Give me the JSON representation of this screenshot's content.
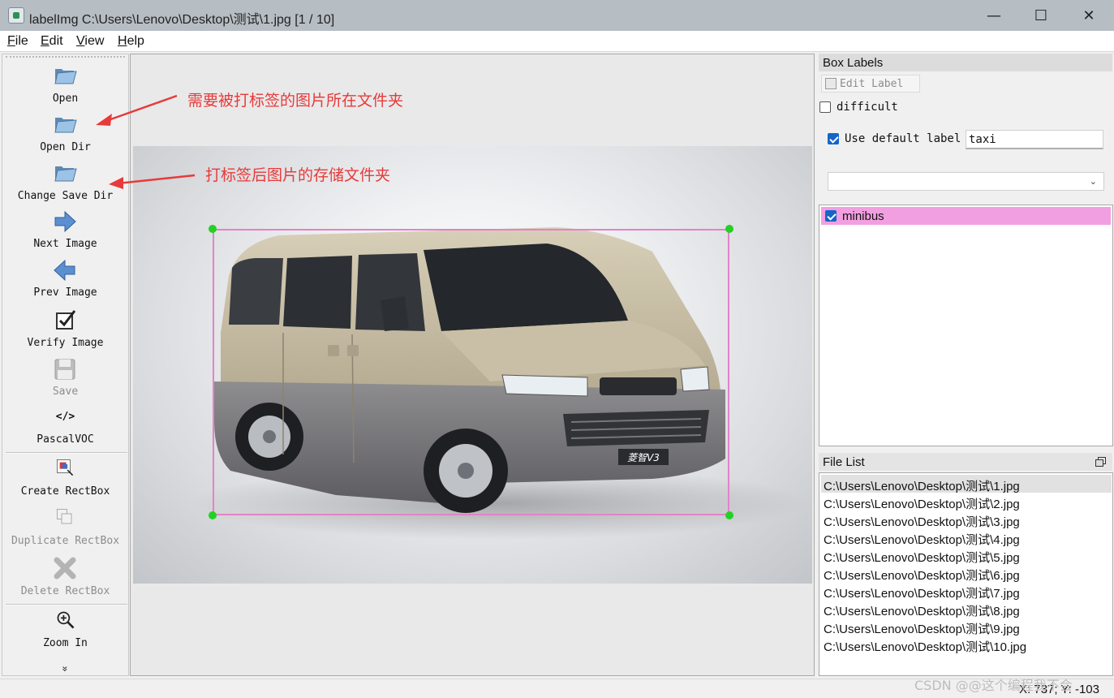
{
  "window": {
    "title": "labelImg C:\\Users\\Lenovo\\Desktop\\测试\\1.jpg [1 / 10]",
    "minimize": "—",
    "maximize": "☐",
    "close": "✕"
  },
  "menu": [
    "File",
    "Edit",
    "View",
    "Help"
  ],
  "toolbar": {
    "open": "Open",
    "open_dir": "Open Dir",
    "change_save_dir": "Change Save Dir",
    "next_image": "Next Image",
    "prev_image": "Prev Image",
    "verify_image": "Verify Image",
    "save": "Save",
    "format_icon_text": "</>",
    "format": "PascalVOC",
    "create_rectbox": "Create RectBox",
    "duplicate_rectbox": "Duplicate RectBox",
    "delete_rectbox": "Delete RectBox",
    "zoom_in": "Zoom In",
    "more": "»"
  },
  "annotations": {
    "open_dir_note": "需要被打标签的图片所在文件夹",
    "save_dir_note": "打标签后图片的存储文件夹"
  },
  "box_labels": {
    "title": "Box Labels",
    "edit_label": "Edit Label",
    "difficult": "difficult",
    "difficult_checked": false,
    "use_default_label": "Use default label",
    "use_default_checked": true,
    "default_label_value": "taxi",
    "combo_value": "",
    "labels": [
      {
        "text": "minibus",
        "checked": true,
        "color": "#f29fe1"
      }
    ]
  },
  "file_list": {
    "title": "File List",
    "files": [
      "C:\\Users\\Lenovo\\Desktop\\测试\\1.jpg",
      "C:\\Users\\Lenovo\\Desktop\\测试\\2.jpg",
      "C:\\Users\\Lenovo\\Desktop\\测试\\3.jpg",
      "C:\\Users\\Lenovo\\Desktop\\测试\\4.jpg",
      "C:\\Users\\Lenovo\\Desktop\\测试\\5.jpg",
      "C:\\Users\\Lenovo\\Desktop\\测试\\6.jpg",
      "C:\\Users\\Lenovo\\Desktop\\测试\\7.jpg",
      "C:\\Users\\Lenovo\\Desktop\\测试\\8.jpg",
      "C:\\Users\\Lenovo\\Desktop\\测试\\9.jpg",
      "C:\\Users\\Lenovo\\Desktop\\测试\\10.jpg"
    ],
    "selected_index": 0
  },
  "status": {
    "coords": "X: 737; Y: -103"
  },
  "watermark": "CSDN @@这个编程我不会",
  "photo": {
    "plate_text": "菱智V3"
  },
  "colors": {
    "bbox": "#e283c8",
    "handle": "#23d023",
    "label_highlight": "#f29fe1",
    "annotation": "#e83a3a"
  }
}
